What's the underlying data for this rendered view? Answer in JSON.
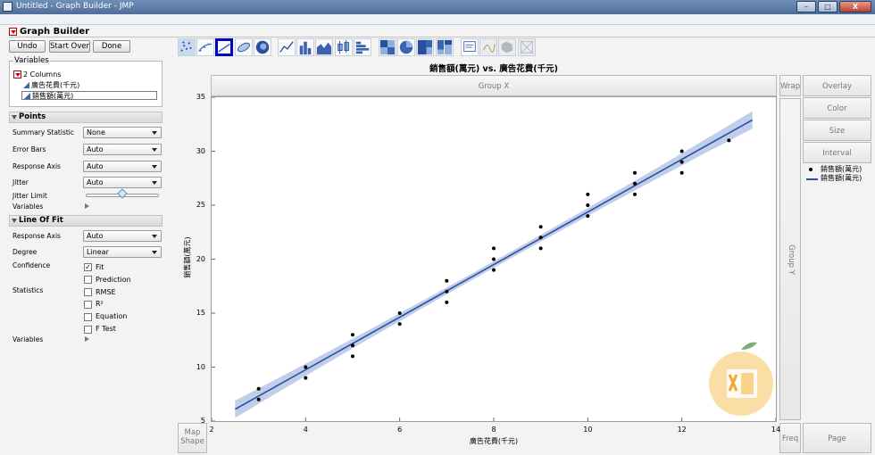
{
  "window": {
    "title": "Untitled - Graph Builder - JMP",
    "minimize": "–",
    "maximize": "□",
    "close": "X"
  },
  "header": {
    "title": "Graph Builder"
  },
  "buttons": {
    "undo": "Undo",
    "start_over": "Start Over",
    "done": "Done"
  },
  "variables": {
    "label": "Variables",
    "count_label": "2 Columns",
    "columns": [
      "廣告花費(千元)",
      "銷售額(萬元)"
    ]
  },
  "points": {
    "section": "Points",
    "summary_statistic": {
      "label": "Summary Statistic",
      "value": "None"
    },
    "error_bars": {
      "label": "Error Bars",
      "value": "Auto"
    },
    "response_axis": {
      "label": "Response Axis",
      "value": "Auto"
    },
    "jitter": {
      "label": "Jitter",
      "value": "Auto"
    },
    "jitter_limit": {
      "label": "Jitter Limit",
      "value": 0.5
    },
    "variables_label": "Variables"
  },
  "line_of_fit": {
    "section": "Line Of Fit",
    "response_axis": {
      "label": "Response Axis",
      "value": "Auto"
    },
    "degree": {
      "label": "Degree",
      "value": "Linear"
    },
    "confidence": {
      "label": "Confidence",
      "options": [
        {
          "label": "Fit",
          "checked": true
        },
        {
          "label": "Prediction",
          "checked": false
        }
      ]
    },
    "statistics": {
      "label": "Statistics",
      "options": [
        {
          "label": "RMSE",
          "checked": false
        },
        {
          "label": "R²",
          "checked": false
        },
        {
          "label": "Equation",
          "checked": false
        },
        {
          "label": "F Test",
          "checked": false
        }
      ]
    },
    "variables_label": "Variables"
  },
  "drop_zones": {
    "group_x": "Group X",
    "group_y": "Group Y",
    "wrap": "Wrap",
    "overlay": "Overlay",
    "color": "Color",
    "size": "Size",
    "interval": "Interval",
    "map_shape": "Map\nShape",
    "freq": "Freq",
    "page": "Page"
  },
  "legend": [
    {
      "marker": "point",
      "label": "銷售額(萬元)"
    },
    {
      "marker": "line",
      "label": "銷售額(萬元)"
    }
  ],
  "colors": {
    "fit_line": "#2d4ea1",
    "confidence_band": "#b5c6e6",
    "points": "#000000",
    "selected_tool": "#0000cc"
  },
  "chart_data": {
    "type": "scatter",
    "title": "銷售額(萬元) vs. 廣告花費(千元)",
    "xlabel": "廣告花費(千元)",
    "ylabel": "銷售額(萬元)",
    "xlim": [
      2,
      14
    ],
    "ylim": [
      5,
      35
    ],
    "xticks": [
      2,
      4,
      6,
      8,
      10,
      12,
      14
    ],
    "yticks": [
      5,
      10,
      15,
      20,
      25,
      30,
      35
    ],
    "grid": false,
    "series": [
      {
        "name": "銷售額(萬元)",
        "points": [
          [
            3,
            7
          ],
          [
            3,
            8
          ],
          [
            4,
            9
          ],
          [
            4,
            10
          ],
          [
            5,
            11
          ],
          [
            5,
            12
          ],
          [
            5,
            13
          ],
          [
            6,
            14
          ],
          [
            6,
            15
          ],
          [
            7,
            16
          ],
          [
            7,
            17
          ],
          [
            7,
            18
          ],
          [
            8,
            19
          ],
          [
            8,
            20
          ],
          [
            8,
            21
          ],
          [
            9,
            21
          ],
          [
            9,
            22
          ],
          [
            9,
            23
          ],
          [
            10,
            24
          ],
          [
            10,
            25
          ],
          [
            10,
            26
          ],
          [
            11,
            26
          ],
          [
            11,
            27
          ],
          [
            11,
            28
          ],
          [
            12,
            28
          ],
          [
            12,
            29
          ],
          [
            12,
            30
          ],
          [
            13,
            31
          ]
        ]
      }
    ],
    "fit": {
      "type": "linear",
      "x": [
        2.5,
        13.5
      ],
      "y": [
        6.1,
        32.9
      ],
      "band_halfwidth_ends": 0.8,
      "band_halfwidth_mid": 0.3
    }
  }
}
